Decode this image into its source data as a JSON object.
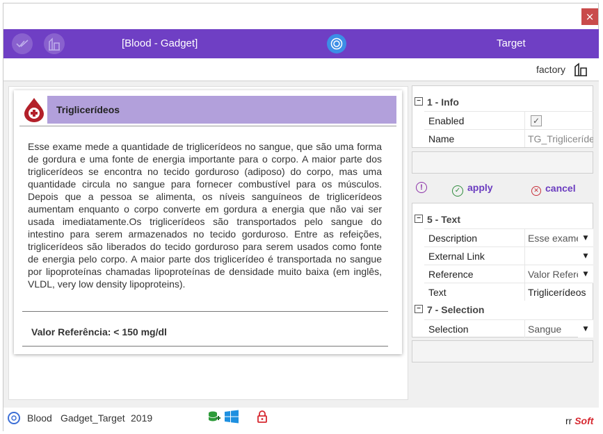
{
  "window": {
    "close_label": "×"
  },
  "header": {
    "title": "[Blood - Gadget]",
    "target_label": "Target",
    "check_icon": "double-check-icon",
    "factory_icon": "factory-icon",
    "target_icon": "target-icon",
    "accent": "#6f3fc4"
  },
  "subbar": {
    "factory_label": "factory"
  },
  "card": {
    "title": "Triglicerídeos",
    "description": "Esse exame mede a quantidade de triglicerídeos no sangue, que são uma forma de gordura e uma fonte de energia importante para o corpo. A maior parte dos triglicerídeos se encontra no tecido gorduroso (adiposo) do corpo, mas uma quantidade circula no sangue para fornecer combustível para os músculos. Depois que a pessoa se alimenta, os níveis sanguíneos de triglicerídeos aumentam enquanto o corpo converte em gordura a energia que não vai ser usada imediatamente.Os triglicerídeos são transportados pelo sangue do intestino para serem armazenados no tecido gorduroso. Entre as refeições, triglicerídeos são liberados do tecido gorduroso para serem usados como fonte de energia pelo corpo. A maior parte dos triglicerídeo é transportada no sangue por lipoproteínas chamadas lipoproteínas de densidade muito baixa (em inglês, VLDL, very low density lipoproteins).",
    "reference": "Valor Referência: < 150 mg/dl"
  },
  "properties": {
    "info": {
      "section": "1 - Info",
      "toggle": "−",
      "enabled_label": "Enabled",
      "enabled_checked": true,
      "name_label": "Name",
      "name_value": "TG_Triglicerídeos"
    },
    "text": {
      "section": "5 - Text",
      "toggle": "−",
      "description_label": "Description",
      "description_value": "Esse exame",
      "external_link_label": "External Link",
      "external_link_value": "",
      "reference_label": "Reference",
      "reference_value": "Valor Referência",
      "text_label": "Text",
      "text_value": "Triglicerídeos"
    },
    "selection": {
      "section": "7 - Selection",
      "toggle": "−",
      "selection_label": "Selection",
      "selection_value": "Sangue"
    }
  },
  "actions": {
    "info": "!",
    "apply_label": "apply",
    "cancel_label": "cancel"
  },
  "status": {
    "app": "Blood",
    "gadget": "Gadget_Target",
    "year": "2019",
    "brand_rr": "rr",
    "brand_soft": "Soft"
  }
}
